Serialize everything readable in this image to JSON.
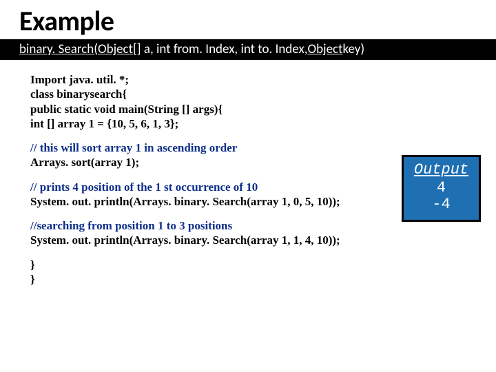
{
  "title": "Example",
  "signature": {
    "p1": "binary. Search(",
    "p2": "Object",
    "p3": "[] a, int from. Index, int to. Index, ",
    "p4": "Object",
    "p5": " key)"
  },
  "code": {
    "l1": "Import java. util. *;",
    "l2": "class binarysearch{",
    "l3": " public static void main(String [] args){",
    "l4": "    int [] array 1 = {10, 5, 6, 1, 3};",
    "l5": "     // this will sort array 1 in ascending order",
    "l6": "      Arrays. sort(array 1);",
    "l7": "     // prints 4 position of the 1 st occurrence of 10",
    "l8": "    System. out. println(Arrays. binary. Search(array 1, 0, 5, 10));",
    "l9": "    //searching from position 1 to 3 positions",
    "l10": "    System. out. println(Arrays. binary. Search(array 1, 1, 4, 10));",
    "l11": "}",
    "l12": "}"
  },
  "output": {
    "heading": "Output",
    "v1": "4",
    "v2": "-4"
  }
}
